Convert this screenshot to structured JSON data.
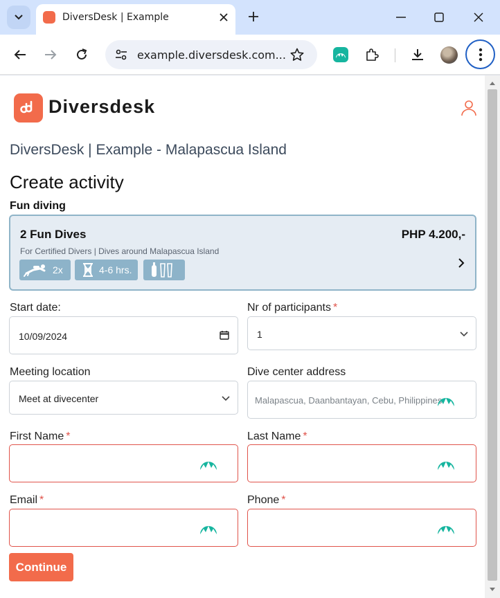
{
  "browser": {
    "tab_title": "DiversDesk | Example",
    "url": "example.diversdesk.com..."
  },
  "header": {
    "brand": "Diversdesk"
  },
  "page": {
    "site_title": "DiversDesk | Example - Malapascua Island",
    "title": "Create activity",
    "section_label": "Fun diving"
  },
  "activity": {
    "name": "2 Fun Dives",
    "price": "PHP 4.200,-",
    "description": "For Certified Divers | Dives around Malapascua Island",
    "dives": "2x",
    "duration": "4-6 hrs."
  },
  "form": {
    "start_date": {
      "label": "Start date:",
      "value": "10/09/2024"
    },
    "participants": {
      "label": "Nr of participants",
      "required": "*",
      "value": "1"
    },
    "meeting_location": {
      "label": "Meeting location",
      "value": "Meet at divecenter"
    },
    "dive_center_address": {
      "label": "Dive center address",
      "value": "Malapascua, Daanbantayan, Cebu, Philippines"
    },
    "first_name": {
      "label": "First Name",
      "required": "*"
    },
    "last_name": {
      "label": "Last Name",
      "required": "*"
    },
    "email": {
      "label": "Email",
      "required": "*"
    },
    "phone": {
      "label": "Phone",
      "required": "*"
    },
    "continue_label": "Continue"
  },
  "colors": {
    "brand": "#f26b4b",
    "card_bg": "#e5ecf3",
    "chip": "#8db3c9",
    "error": "#e0534a",
    "nord": "#16b59f"
  }
}
